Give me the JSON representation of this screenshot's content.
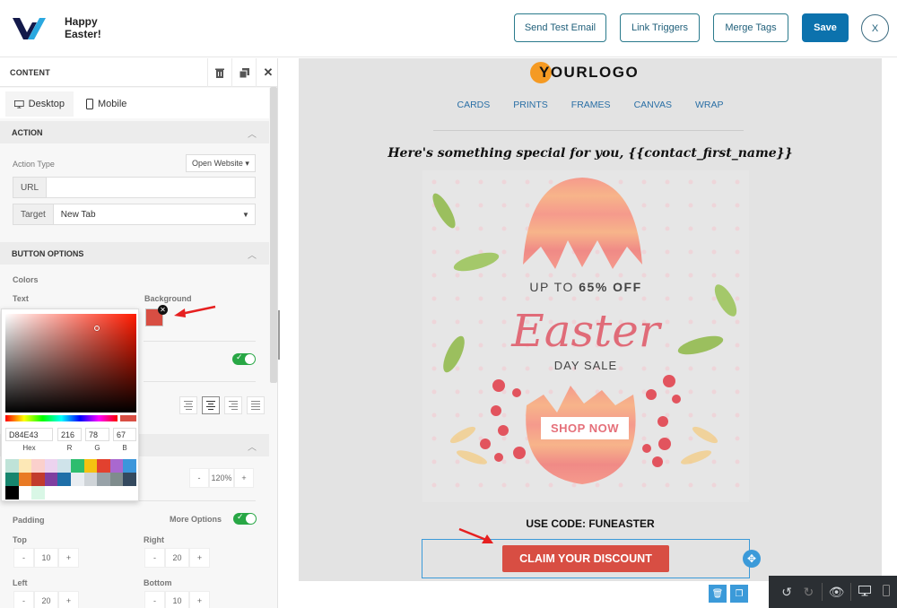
{
  "app": {
    "title_line1": "Happy",
    "title_line2": "Easter!"
  },
  "toolbar": {
    "send_test": "Send Test Email",
    "link_triggers": "Link Triggers",
    "merge_tags": "Merge Tags",
    "save": "Save",
    "close": "X"
  },
  "panel": {
    "title": "CONTENT",
    "tabs": [
      {
        "label": "Desktop"
      },
      {
        "label": "Mobile"
      }
    ],
    "action": {
      "section_title": "ACTION",
      "action_type_label": "Action Type",
      "action_type_value": "Open Website ▾",
      "url_label": "URL",
      "url_value": "",
      "target_label": "Target",
      "target_value": "New Tab"
    },
    "button_options": {
      "section_title": "BUTTON OPTIONS",
      "colors_label": "Colors",
      "text_label": "Text",
      "background_label": "Background",
      "background_color": "#d84e43",
      "toggle_on": true,
      "alignment_selected": "center"
    },
    "line_height_value": "120%",
    "padding": {
      "label": "Padding",
      "more_options_label": "More Options",
      "more_options_on": true,
      "top_label": "Top",
      "top": "10",
      "right_label": "Right",
      "right": "20",
      "left_label": "Left",
      "left": "20",
      "bottom_label": "Bottom",
      "bottom": "10"
    }
  },
  "color_picker": {
    "hex": "D84E43",
    "r": "216",
    "g": "78",
    "b": "67",
    "hex_label": "Hex",
    "r_label": "R",
    "g_label": "G",
    "b_label": "B",
    "palette": [
      "#bfe3d8",
      "#fde8b6",
      "#fbd0cc",
      "#ecd3ef",
      "#cfe3ea",
      "#2ebd6e",
      "#f5c211",
      "#e2412f",
      "#a968cf",
      "#3b96db",
      "#17866e",
      "#e97a24",
      "#c23b2d",
      "#7f3fa0",
      "#1f6fa8",
      "#e9edf1",
      "#cfd4d8",
      "#98a2a8",
      "#7f8c8d",
      "#34495e",
      "#000000",
      "#ffffff",
      "#d9f7e6"
    ]
  },
  "email": {
    "logo_text": "YOURLOGO",
    "nav": [
      "CARDS",
      "PRINTS",
      "FRAMES",
      "CANVAS",
      "WRAP"
    ],
    "greeting": "Here's something special for you, {{contact_first_name}}",
    "hero": {
      "discount_prefix": "UP TO ",
      "discount_value": "65% OFF",
      "title": "Easter",
      "subtitle": "DAY SALE",
      "shop_button": "SHOP NOW"
    },
    "code_text": "USE CODE: FUNEASTER",
    "cta_button": "CLAIM YOUR DISCOUNT",
    "cta_color": "#d84e43"
  }
}
